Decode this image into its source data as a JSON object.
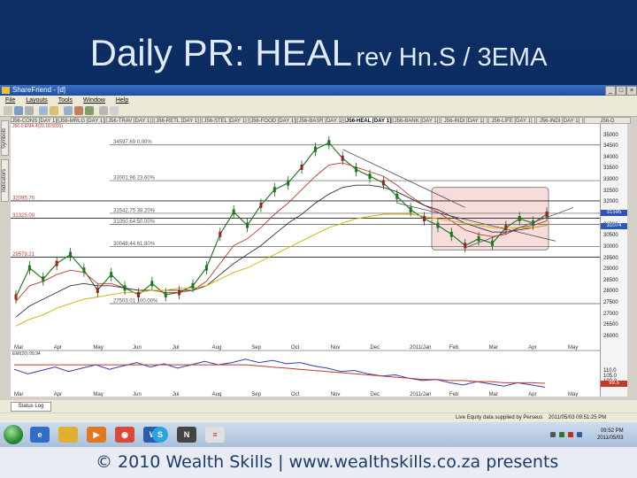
{
  "slide": {
    "title_main": "Daily PR: HEAL",
    "title_suffix": "rev Hn.S / 3EMA",
    "footer": "© 2010 Wealth Skills | www.wealthskills.co.za presents"
  },
  "window": {
    "title": "ShareFriend - [d]",
    "menu": [
      "File",
      "Layouts",
      "Tools",
      "Window",
      "Help"
    ],
    "controls": [
      "_",
      "□",
      "×"
    ]
  },
  "tabs": [
    "J56-CONS [DAY 1]",
    "J56-MRLG [DAY 1]",
    "J56-TRAV [DAY 1]",
    "J56-RETL [DAY 1]",
    "J56-STEL [DAY 1]",
    "J56-FOOD [DAY 1]",
    "J56-BASR [DAY 1]",
    "J56-HEAL [DAY 1]",
    "J56-BANK [DAY 1]",
    "J56-INDI [DAY 1]",
    "J56-LIFE [DAY 1]",
    "J56-INDI [DAY 1]",
    "J56-D"
  ],
  "active_tab_index": 7,
  "side_tabs": [
    "Symbols",
    "Indicators"
  ],
  "chart_data": [
    {
      "type": "line",
      "name": "price",
      "legend": "J56-0 EMA 4(20,10,5020)",
      "x_labels": [
        "Mar",
        "Apr",
        "May",
        "Jun",
        "Jul",
        "Aug",
        "Sep",
        "Oct",
        "Nov",
        "Dec",
        "2011/Jan",
        "Feb",
        "Mar",
        "Apr",
        "May"
      ],
      "series": [
        {
          "name": "close",
          "color": "#2a7a2a",
          "values": [
            27800,
            29100,
            28600,
            29300,
            29700,
            29000,
            28100,
            28800,
            28200,
            27900,
            28400,
            27900,
            28000,
            28300,
            29100,
            30600,
            31600,
            31000,
            31900,
            32600,
            32900,
            33600,
            34400,
            34700,
            34000,
            33500,
            33200,
            32900,
            32300,
            31700,
            31300,
            31000,
            30600,
            30100,
            30400,
            30200,
            30900,
            31300,
            31100,
            31500
          ]
        },
        {
          "name": "ema_fast",
          "color": "#c0392b",
          "values": [
            27600,
            28300,
            28500,
            28800,
            29000,
            28900,
            28400,
            28400,
            28200,
            28100,
            28100,
            28000,
            28000,
            28100,
            28500,
            29300,
            30100,
            30400,
            30900,
            31500,
            32000,
            32600,
            33200,
            33700,
            33800,
            33600,
            33400,
            33200,
            32800,
            32300,
            31900,
            31600,
            31200,
            30800,
            30600,
            30500,
            30600,
            30900,
            31000,
            31200
          ]
        },
        {
          "name": "ema_mid",
          "color": "#333333",
          "values": [
            26900,
            27400,
            27700,
            28000,
            28300,
            28400,
            28300,
            28300,
            28200,
            28100,
            28100,
            28100,
            28100,
            28100,
            28300,
            28800,
            29300,
            29700,
            30100,
            30600,
            31100,
            31500,
            32000,
            32400,
            32700,
            32800,
            32800,
            32700,
            32500,
            32200,
            31900,
            31700,
            31400,
            31100,
            30900,
            30700,
            30700,
            30800,
            30900,
            31000
          ]
        },
        {
          "name": "ema_slow",
          "color": "#d4b000",
          "values": [
            26500,
            26800,
            27000,
            27300,
            27500,
            27700,
            27800,
            27900,
            28000,
            28000,
            28100,
            28100,
            28200,
            28200,
            28300,
            28600,
            28900,
            29100,
            29400,
            29700,
            30000,
            30300,
            30600,
            30900,
            31100,
            31300,
            31400,
            31500,
            31500,
            31500,
            31400,
            31300,
            31200,
            31100,
            31000,
            30900,
            30900,
            30900,
            30900,
            31000
          ]
        }
      ],
      "fib_levels": [
        {
          "label": "34597.69 0.00%",
          "value": 34597.69
        },
        {
          "label": "33001.96 23.60%",
          "value": 33001.96
        },
        {
          "label": "32095.70",
          "value": 32095.7
        },
        {
          "label": "31325.00",
          "value": 31325.0
        },
        {
          "label": "31542.75 38.20%",
          "value": 31542.75
        },
        {
          "label": "31050.64 50.00%",
          "value": 31050.64
        },
        {
          "label": "29579.21",
          "value": 29579.21
        },
        {
          "label": "30048.44 61.80%",
          "value": 30048.44
        },
        {
          "label": "27503.01 100.00%",
          "value": 27503.01
        }
      ],
      "left_price_labels": [
        "32095.70",
        "31325.00",
        "29579.21"
      ],
      "y_ticks": [
        "35000",
        "34500",
        "34000",
        "33500",
        "33000",
        "32500",
        "32000",
        "31500",
        "31000",
        "30500",
        "30000",
        "29500",
        "29000",
        "28500",
        "28000",
        "27500",
        "27000",
        "26500",
        "26000"
      ],
      "ylim": [
        25800,
        35300
      ],
      "highlight_tags": [
        "31595",
        "31030",
        "31074"
      ]
    },
    {
      "type": "line",
      "name": "indicator",
      "legend": "EMI(20) 99.94",
      "series": [
        {
          "name": "indicator",
          "color": "#3040b0",
          "values": [
            112,
            108,
            111,
            114,
            110,
            113,
            116,
            112,
            115,
            118,
            114,
            117,
            113,
            116,
            119,
            116,
            118,
            121,
            118,
            120,
            117,
            118,
            115,
            113,
            110,
            111,
            108,
            106,
            107,
            104,
            102,
            103,
            100,
            98,
            101,
            99,
            97,
            100,
            98,
            96
          ]
        },
        {
          "name": "signal",
          "color": "#c0392b",
          "values": [
            116,
            116,
            116,
            116,
            116,
            116,
            116,
            116,
            116,
            116,
            116,
            116,
            116,
            116,
            116,
            116,
            116,
            116,
            115,
            114,
            113,
            112,
            111,
            110,
            109,
            108,
            107,
            106,
            105,
            104,
            103,
            103,
            102,
            102,
            101,
            101,
            100,
            100,
            100,
            99.5
          ]
        }
      ],
      "y_ticks": [
        "110.0",
        "105.0",
        "100.0"
      ],
      "last_value_tag": "99.5",
      "ylim": [
        94,
        124
      ]
    }
  ],
  "status": {
    "tab": "Status Log",
    "data_supplier": "Live Equity data supplied by Perseus",
    "timestamp": "2011/05/03 09:51:25 PM"
  },
  "taskbar": {
    "icons": [
      "start-orb",
      "internet-explorer",
      "explorer-folder",
      "media-player",
      "chrome",
      "word",
      "skype",
      "news-app",
      "file-viewer"
    ],
    "clock_time": "09:52 PM",
    "clock_date": "2011/05/03"
  }
}
